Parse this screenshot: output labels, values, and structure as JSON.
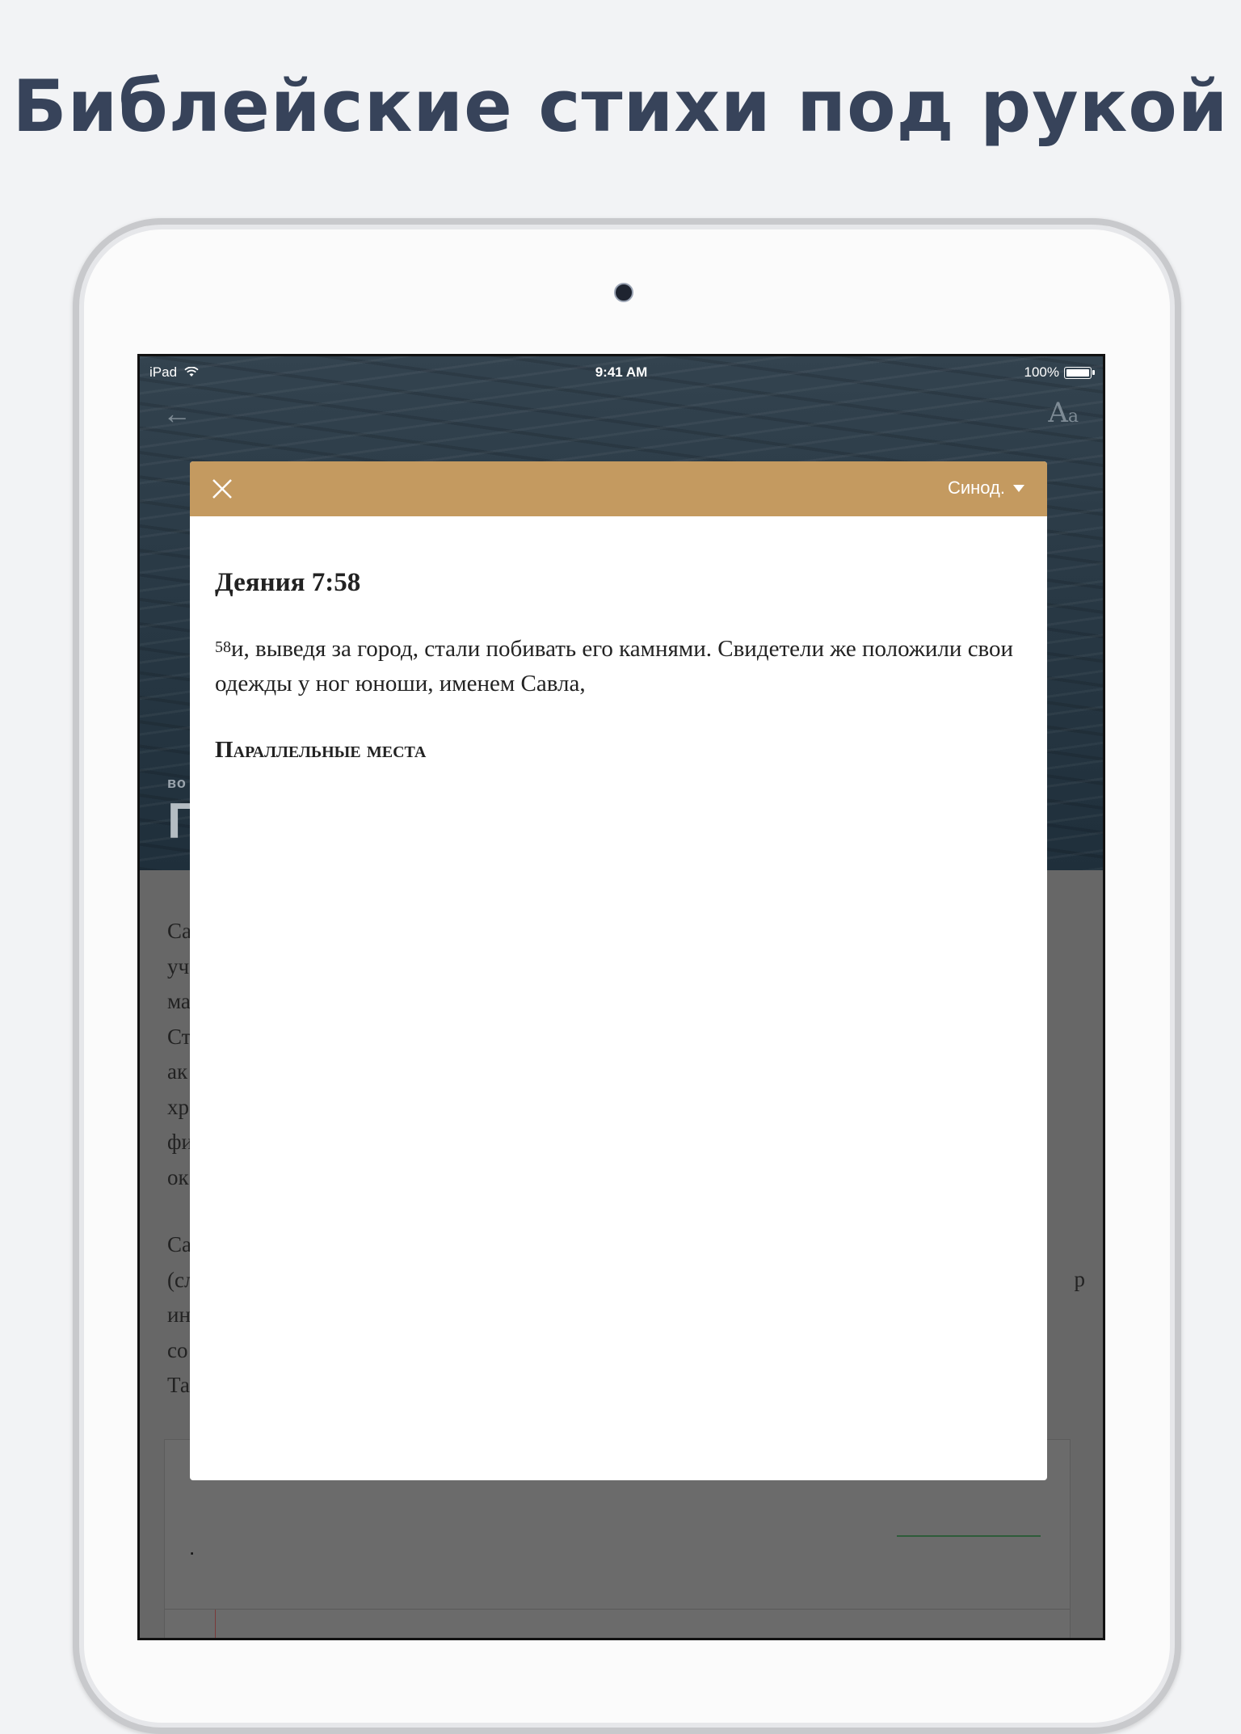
{
  "headline": "Библейские стихи под рукой",
  "status_bar": {
    "device": "iPad",
    "time": "9:41 AM",
    "battery": "100%"
  },
  "background": {
    "subtitle_fragment": "во",
    "title_fragment": "Г",
    "text_fragments_p1": [
      "Са",
      "уч",
      "ма",
      "Ст",
      "ак",
      "хр",
      "фи",
      "ок"
    ],
    "text_fragments_p2": [
      "Са",
      "(сл",
      "ин",
      "со",
      "Та"
    ],
    "text_fragment_right": "р"
  },
  "modal": {
    "translation_selector": "Синод.",
    "reference": "Деяния 7:58",
    "verse_number": "58",
    "verse_text": "и, выведя за город, стали побивать его камнями. Свидетели же положили свои одежды у ног юноши, именем Савла,",
    "section_heading": "Параллельные места"
  },
  "colors": {
    "headline": "#37435a",
    "modal_header": "#c49a60",
    "overlay": "#676767"
  },
  "icons": {
    "back": "arrow-left-icon",
    "text_size": "text-size-icon",
    "close": "close-icon",
    "dropdown": "caret-down-icon",
    "wifi": "wifi-icon",
    "battery": "battery-icon"
  }
}
